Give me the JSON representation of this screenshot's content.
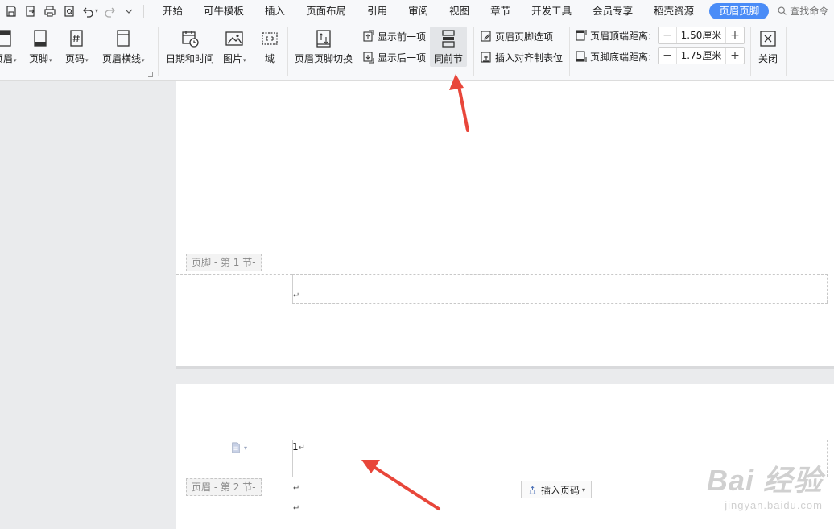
{
  "menu": {
    "tabs": [
      "开始",
      "可牛模板",
      "插入",
      "页面布局",
      "引用",
      "审阅",
      "视图",
      "章节",
      "开发工具",
      "会员专享",
      "稻壳资源"
    ],
    "active_tab": "页眉页脚",
    "search_label": "查找命令"
  },
  "ribbon": {
    "header_label": "页眉",
    "footer_label": "页脚",
    "page_number_label": "页码",
    "header_line_label": "页眉横线",
    "date_time_label": "日期和时间",
    "picture_label": "图片",
    "field_label": "域",
    "switch_label": "页眉页脚切换",
    "show_prev_label": "显示前一项",
    "show_next_label": "显示后一项",
    "same_as_prev_label": "同前节",
    "options_label": "页眉页脚选项",
    "insert_align_tab_label": "插入对齐制表位",
    "header_top_distance_label": "页眉顶端距离:",
    "header_top_distance_value": "1.50厘米",
    "footer_bottom_distance_label": "页脚底端距离:",
    "footer_bottom_distance_value": "1.75厘米",
    "close_label": "关闭"
  },
  "document": {
    "footer_section1_tag": "页脚 - 第 1 节-",
    "header_section2_tag": "页眉 - 第 2 节-",
    "page_number_text": "1",
    "paragraph_mark": "↵",
    "insert_page_number_label": "插入页码"
  },
  "watermark": {
    "brand": "Bai  经验",
    "url": "jingyan.baidu.com"
  },
  "colors": {
    "accent": "#4a8cf7",
    "arrow": "#e8463a"
  }
}
